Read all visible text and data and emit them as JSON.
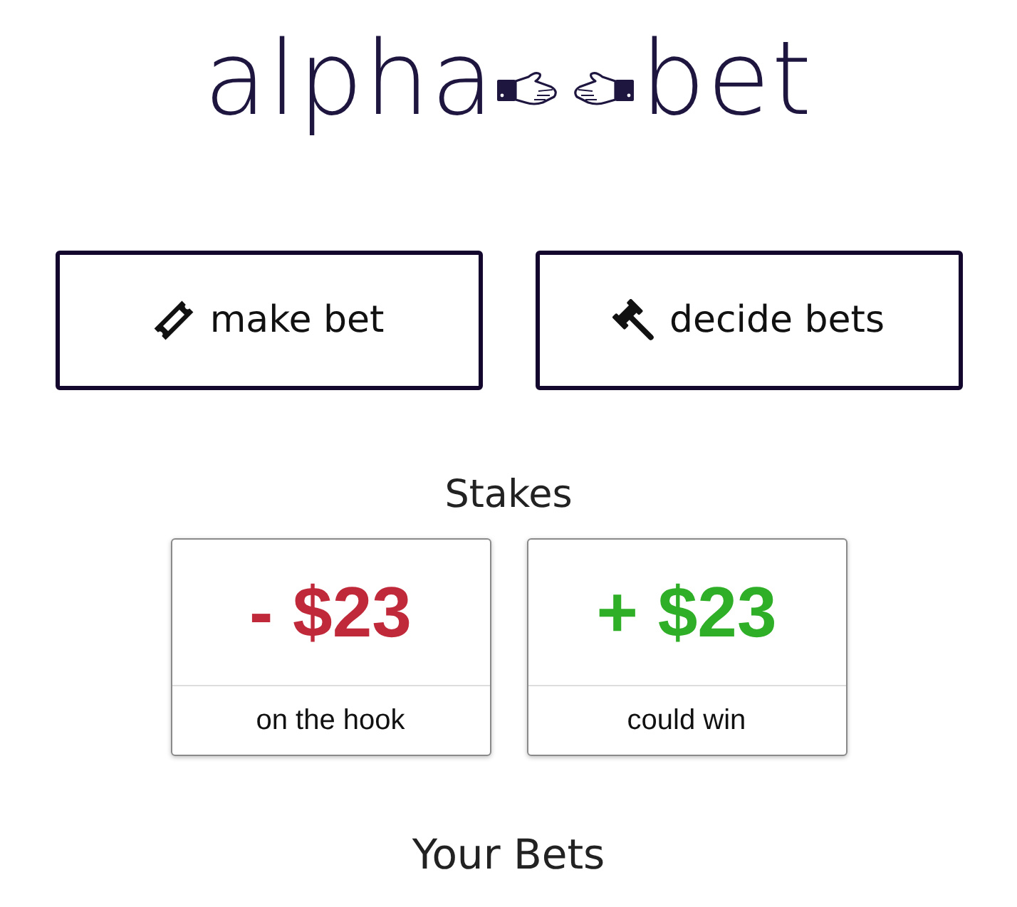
{
  "logo": {
    "text_before": "alpha",
    "text_after": "bet"
  },
  "actions": [
    {
      "kind": "ticket",
      "label": "make bet"
    },
    {
      "kind": "gavel",
      "label": "decide bets"
    }
  ],
  "stakes": {
    "title": "Stakes",
    "items": [
      {
        "amount": "- $23",
        "label": "on the hook",
        "color": "#c0293a"
      },
      {
        "amount": "+ $23",
        "label": "could win",
        "color": "#2fae27"
      }
    ]
  },
  "bets": {
    "title": "Your Bets"
  }
}
